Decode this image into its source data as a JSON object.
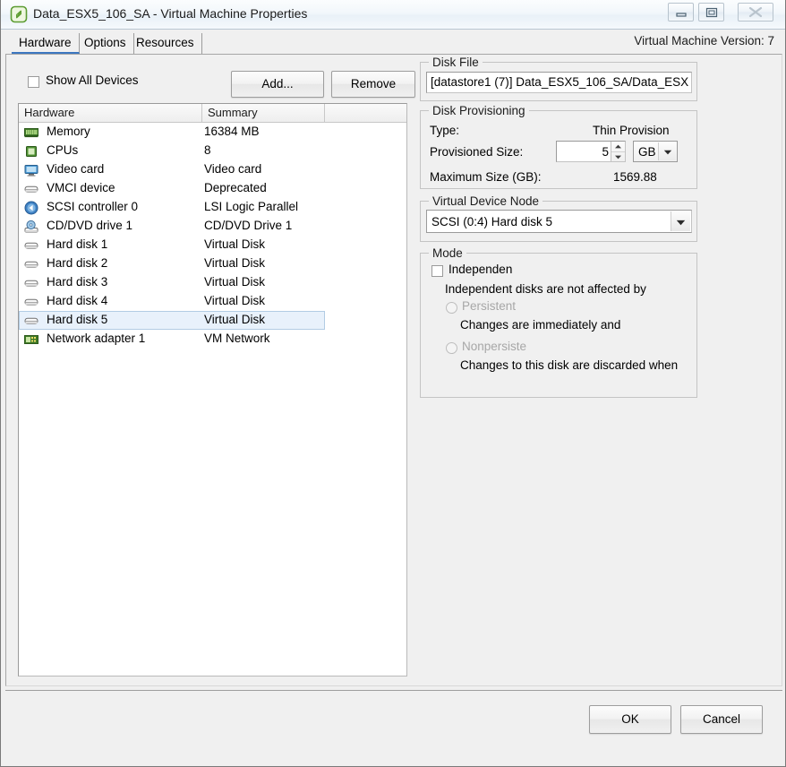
{
  "window": {
    "title": "Data_ESX5_106_SA - Virtual Machine Properties",
    "icon": "vm-icon",
    "controls": {
      "minimize": "minimize-icon",
      "maximize": "maximize-icon",
      "close": "close-icon"
    }
  },
  "tabs": [
    {
      "label": "Hardware",
      "selected": true
    },
    {
      "label": "Options",
      "selected": false
    },
    {
      "label": "Resources",
      "selected": false
    }
  ],
  "vm_version": "Virtual Machine Version: 7",
  "toolbar": {
    "show_all_devices_label": "Show All Devices",
    "show_all_devices_checked": false,
    "add_label": "Add...",
    "remove_label": "Remove"
  },
  "hardware_list": {
    "columns": [
      "Hardware",
      "Summary",
      ""
    ],
    "rows": [
      {
        "icon": "memory-icon",
        "name": "Memory",
        "summary": "16384 MB",
        "selected": false
      },
      {
        "icon": "cpu-icon",
        "name": "CPUs",
        "summary": "8",
        "selected": false
      },
      {
        "icon": "video-card-icon",
        "name": "Video card",
        "summary": "Video card",
        "selected": false
      },
      {
        "icon": "vmci-device-icon",
        "name": "VMCI device",
        "summary": "Deprecated",
        "selected": false
      },
      {
        "icon": "scsi-controller-icon",
        "name": "SCSI controller 0",
        "summary": "LSI Logic Parallel",
        "selected": false
      },
      {
        "icon": "cd-dvd-drive-icon",
        "name": "CD/DVD drive 1",
        "summary": "CD/DVD Drive 1",
        "selected": false
      },
      {
        "icon": "hard-disk-icon",
        "name": "Hard disk 1",
        "summary": "Virtual Disk",
        "selected": false
      },
      {
        "icon": "hard-disk-icon",
        "name": "Hard disk 2",
        "summary": "Virtual Disk",
        "selected": false
      },
      {
        "icon": "hard-disk-icon",
        "name": "Hard disk 3",
        "summary": "Virtual Disk",
        "selected": false
      },
      {
        "icon": "hard-disk-icon",
        "name": "Hard disk 4",
        "summary": "Virtual Disk",
        "selected": false
      },
      {
        "icon": "hard-disk-icon",
        "name": "Hard disk 5",
        "summary": "Virtual Disk",
        "selected": true
      },
      {
        "icon": "network-adapter-icon",
        "name": "Network adapter 1",
        "summary": "VM Network",
        "selected": false
      }
    ]
  },
  "disk_file": {
    "group_title": "Disk File",
    "value": "[datastore1 (7)] Data_ESX5_106_SA/Data_ESX"
  },
  "disk_provisioning": {
    "group_title": "Disk Provisioning",
    "type_label": "Type:",
    "type_value": "Thin Provision",
    "provisioned_size_label": "Provisioned Size:",
    "provisioned_size_value": "5",
    "unit_value": "GB",
    "maximum_size_label": "Maximum Size (GB):",
    "maximum_size_value": "1569.88"
  },
  "virtual_device_node": {
    "group_title": "Virtual Device Node",
    "value": "SCSI (0:4) Hard disk 5"
  },
  "mode": {
    "group_title": "Mode",
    "independent_label": "Independen",
    "independent_checked": false,
    "independent_description": "Independent disks are not affected by",
    "persistent_label": "Persistent",
    "persistent_description": "Changes are immediately and",
    "nonpersistent_label": "Nonpersiste",
    "nonpersistent_description": "Changes to this disk are discarded when"
  },
  "footer": {
    "ok_label": "OK",
    "cancel_label": "Cancel"
  },
  "colors": {
    "selection_fill": "#e8f1fb",
    "selection_border": "#b2cce4",
    "titlebar_border": "#b8c6d2",
    "dialog_background": "#f0f0f0"
  }
}
